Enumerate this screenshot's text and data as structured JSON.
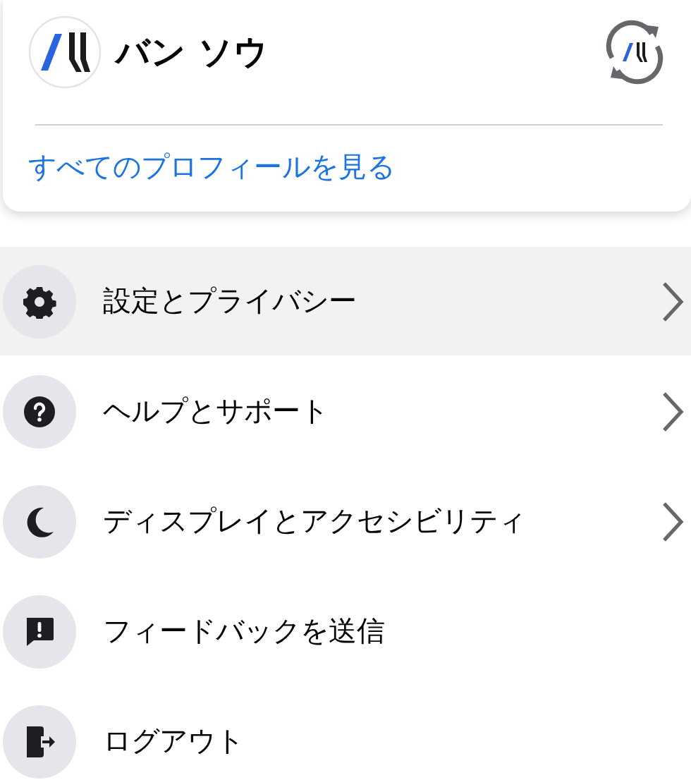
{
  "profile": {
    "name": "バン ソウ",
    "link": "すべてのプロフィールを見る"
  },
  "menu": [
    {
      "kind": "settings",
      "label": "設定とプライバシー",
      "highlighted": true,
      "has_submenu": true
    },
    {
      "kind": "help",
      "label": "ヘルプとサポート",
      "highlighted": false,
      "has_submenu": true
    },
    {
      "kind": "display",
      "label": "ディスプレイとアクセシビリティ",
      "highlighted": false,
      "has_submenu": true
    },
    {
      "kind": "feedback",
      "label": "フィードバックを送信",
      "highlighted": false,
      "has_submenu": false
    },
    {
      "kind": "logout",
      "label": "ログアウト",
      "highlighted": false,
      "has_submenu": false
    }
  ]
}
